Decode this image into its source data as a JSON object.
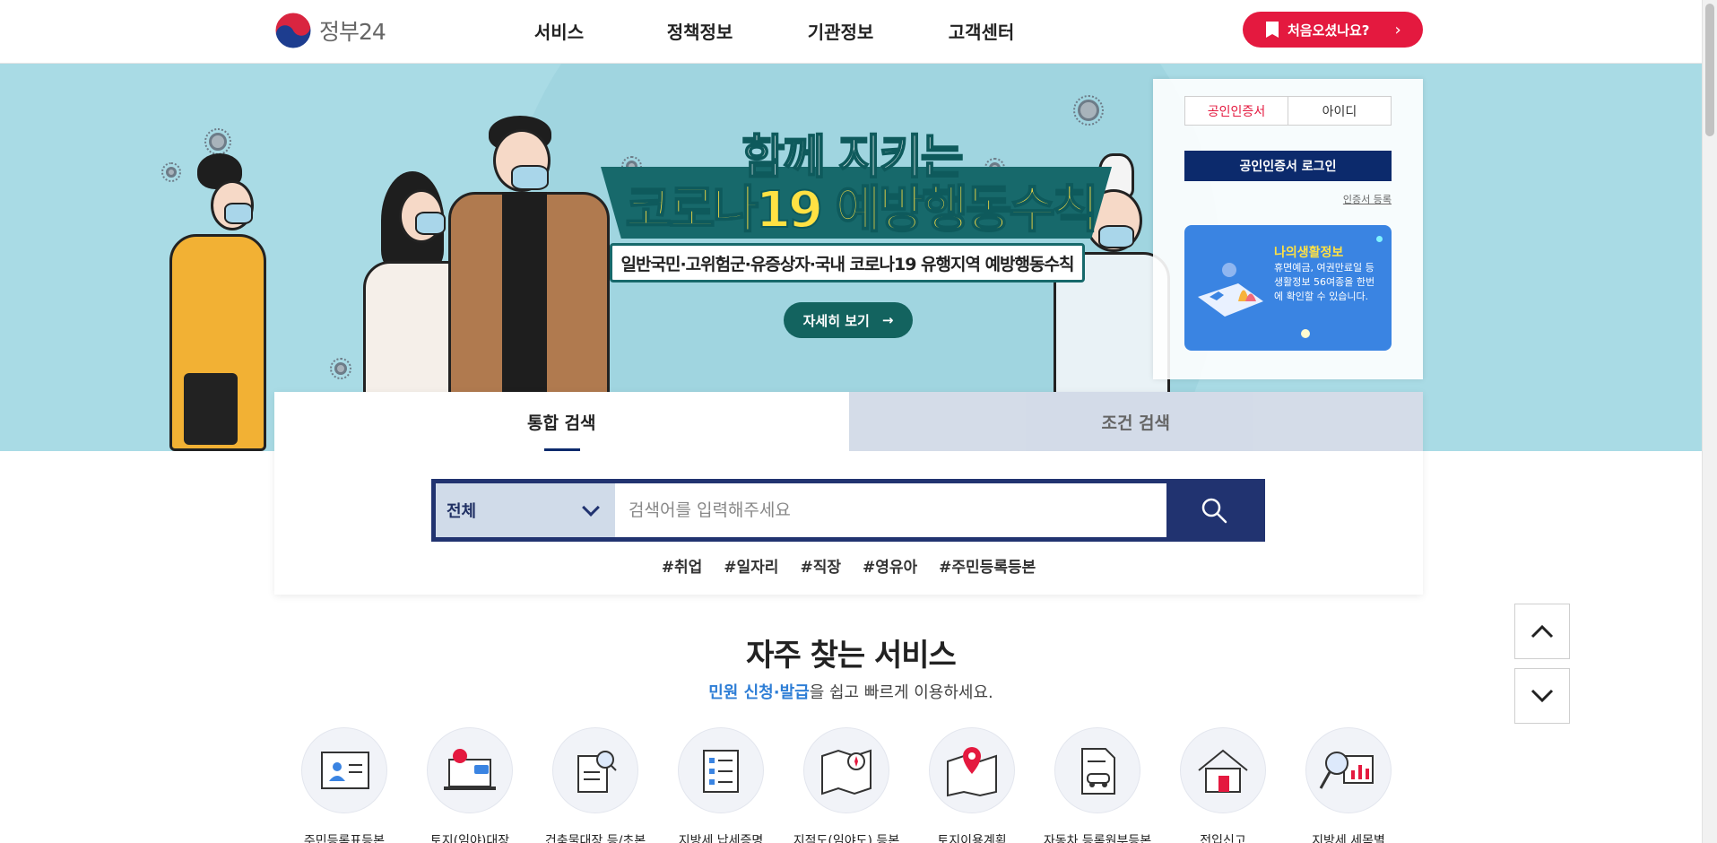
{
  "header": {
    "logo_text": "정부24",
    "nav": [
      "서비스",
      "정책정보",
      "기관정보",
      "고객센터"
    ],
    "first_visit_label": "처음오셨나요?",
    "colors": {
      "accent_red": "#e4193f",
      "navy": "#213370"
    }
  },
  "hero": {
    "title_line1": "함께 지키는",
    "title_line2": "코로나19 예방행동수칙",
    "subtitle": "일반국민·고위험군·유증상자·국내 코로나19 유행지역 예방행동수칙",
    "detail_button": "자세히 보기"
  },
  "login": {
    "tabs": [
      "공인인증서",
      "아이디"
    ],
    "login_button": "공인인증서 로그인",
    "cert_register_link": "인증서 등록",
    "life_info_title": "나의생활정보",
    "life_info_text": "휴면예금, 여권만료일 등 생활정보 56여종을 한번에 확인할 수 있습니다."
  },
  "search": {
    "tabs": [
      "통합 검색",
      "조건 검색"
    ],
    "category": "전체",
    "placeholder": "검색어를 입력해주세요",
    "tags": [
      "#취업",
      "#일자리",
      "#직장",
      "#영유아",
      "#주민등록등본"
    ]
  },
  "services": {
    "title": "자주 찾는 서비스",
    "subtitle_highlight": "민원 신청·발급",
    "subtitle_rest": "을 쉽고 빠르게 이용하세요.",
    "items": [
      {
        "label": "주민등록표등본",
        "icon": "id-card-icon"
      },
      {
        "label": "토지(임야)대장",
        "icon": "laptop-map-pin-icon"
      },
      {
        "label": "건축물대장 등/초본",
        "icon": "document-search-icon"
      },
      {
        "label": "지방세 납세증명",
        "icon": "checklist-icon"
      },
      {
        "label": "지적도(임야도) 등본",
        "icon": "map-compass-icon"
      },
      {
        "label": "토지이용계획",
        "icon": "map-pin-icon"
      },
      {
        "label": "자동차 등록원부등본",
        "icon": "car-document-icon"
      },
      {
        "label": "전입신고",
        "icon": "house-icon"
      },
      {
        "label": "지방세 세목별",
        "icon": "magnifier-chart-icon"
      }
    ]
  }
}
